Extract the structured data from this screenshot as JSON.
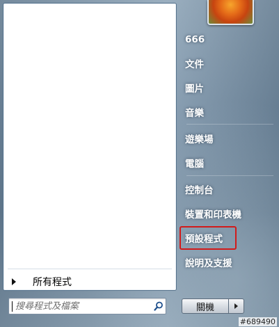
{
  "left_pane": {
    "all_programs_label": "所有程式"
  },
  "search": {
    "placeholder": "搜尋程式及檔案",
    "icon": "search-icon"
  },
  "user": {
    "picture_icon": "flower-avatar"
  },
  "right_menu": {
    "items": [
      {
        "label": "666"
      },
      {
        "label": "文件"
      },
      {
        "label": "圖片"
      },
      {
        "label": "音樂"
      },
      {
        "label": "遊樂場"
      },
      {
        "label": "電腦"
      },
      {
        "label": "控制台"
      },
      {
        "label": "裝置和印表機"
      },
      {
        "label": "預設程式"
      },
      {
        "label": "說明及支援"
      }
    ],
    "highlighted_item": "預設程式",
    "highlight_color": "#d21a1a"
  },
  "shutdown": {
    "label": "關機"
  },
  "watermark": "#689490"
}
